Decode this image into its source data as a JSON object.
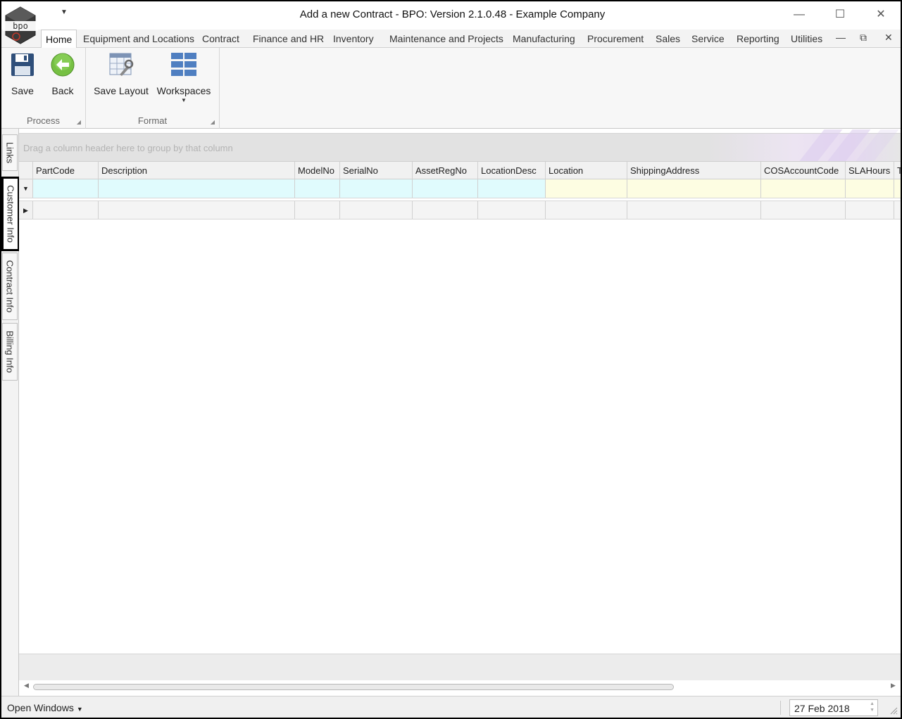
{
  "window": {
    "title": "Add a new Contract - BPO: Version 2.1.0.48 - Example Company",
    "logo_text": "bpo"
  },
  "ribbon_tabs": [
    {
      "label": "Home",
      "active": true
    },
    {
      "label": "Equipment and Locations"
    },
    {
      "label": "Contract"
    },
    {
      "label": "Finance and HR"
    },
    {
      "label": "Inventory"
    },
    {
      "label": "Maintenance and Projects"
    },
    {
      "label": "Manufacturing"
    },
    {
      "label": "Procurement"
    },
    {
      "label": "Sales"
    },
    {
      "label": "Service"
    },
    {
      "label": "Reporting"
    },
    {
      "label": "Utilities"
    }
  ],
  "ribbon": {
    "process": {
      "label": "Process",
      "save": "Save",
      "back": "Back"
    },
    "format": {
      "label": "Format",
      "save_layout": "Save Layout",
      "workspaces": "Workspaces"
    }
  },
  "side_tabs": [
    "Links",
    "Customer Info",
    "Contract Info",
    "Billing Info"
  ],
  "grid": {
    "group_hint": "Drag a column header here to group by that column",
    "columns": [
      "PartCode",
      "Description",
      "ModelNo",
      "SerialNo",
      "AssetRegNo",
      "LocationDesc",
      "Location",
      "ShippingAddress",
      "COSAccountCode",
      "SLAHours",
      "T"
    ]
  },
  "statusbar": {
    "open_windows": "Open Windows",
    "date": "27 Feb 2018"
  },
  "colors": {
    "new_row_cyan": "#e0fbfd",
    "new_row_yellow": "#fdfde2",
    "back_green": "#76c043"
  }
}
